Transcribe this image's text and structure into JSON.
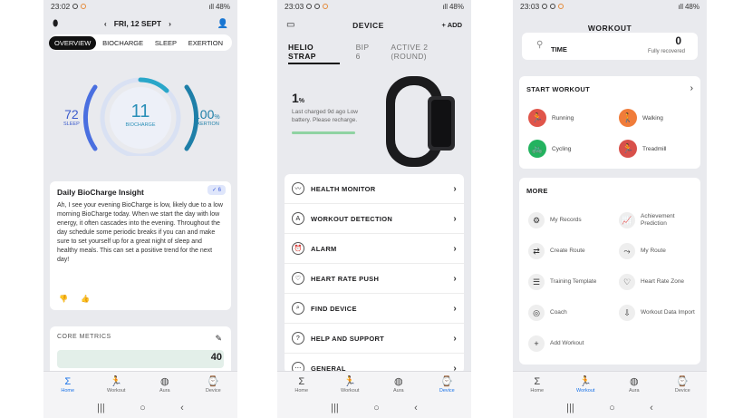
{
  "phone1": {
    "status": {
      "time": "23:02",
      "battery": "48%"
    },
    "date_label": "FRI, 12 SEPT",
    "tabs": [
      "OVERVIEW",
      "BIOCHARGE",
      "SLEEP",
      "EXERTION"
    ],
    "gauges": {
      "sleep": {
        "value": "72",
        "label": "SLEEP"
      },
      "biocharge": {
        "value": "11",
        "label": "BIOCHARGE"
      },
      "exertion": {
        "value": "100",
        "unit": "%",
        "label": "EXERTION"
      }
    },
    "insight": {
      "title": "Daily BioCharge Insight",
      "badge": "6",
      "text": "Ah, I see your evening BioCharge is low, likely due to a low morning BioCharge today. When we start the day with low energy, it often cascades into the evening. Throughout the day schedule some periodic breaks if you can and make sure to set yourself up for a great night of sleep and healthy meals. This can set a positive trend for the next day!"
    },
    "core": {
      "title": "CORE METRICS",
      "value": "40"
    },
    "nav": [
      "Home",
      "Workout",
      "Aura",
      "Device"
    ]
  },
  "phone2": {
    "status": {
      "time": "23:03",
      "battery": "48%"
    },
    "title": "DEVICE",
    "add_label": "ADD",
    "device_tabs": [
      "HELIO STRAP",
      "BIP 6",
      "ACTIVE 2 (ROUND)"
    ],
    "battery": {
      "value": "1",
      "unit": "%",
      "note": "Last charged 9d ago Low battery. Please recharge.",
      "level": 0.01
    },
    "menu": [
      {
        "label": "HEALTH MONITOR",
        "icon": "heart-monitor-icon",
        "glyph": "〰"
      },
      {
        "label": "WORKOUT DETECTION",
        "icon": "workout-detection-icon",
        "glyph": "A"
      },
      {
        "label": "ALARM",
        "icon": "alarm-icon",
        "glyph": "⏰"
      },
      {
        "label": "HEART RATE PUSH",
        "icon": "heart-icon",
        "glyph": "♡"
      },
      {
        "label": "FIND DEVICE",
        "icon": "find-device-icon",
        "glyph": "⌕"
      },
      {
        "label": "HELP AND SUPPORT",
        "icon": "help-icon",
        "glyph": "?"
      },
      {
        "label": "GENERAL",
        "icon": "more-icon",
        "glyph": "⋯"
      }
    ],
    "nav": [
      "Home",
      "Workout",
      "Aura",
      "Device"
    ]
  },
  "phone3": {
    "status": {
      "time": "23:03",
      "battery": "48%"
    },
    "title": "WORKOUT",
    "time_card": {
      "label": "TIME",
      "status": "Fully recovered",
      "value": "0"
    },
    "start_title": "START WORKOUT",
    "activities": [
      {
        "label": "Running",
        "color": "#e0554a",
        "icon": "running-icon"
      },
      {
        "label": "Walking",
        "color": "#f07c3a",
        "icon": "walking-icon"
      },
      {
        "label": "Cycling",
        "color": "#23b35f",
        "icon": "cycling-icon"
      },
      {
        "label": "Treadmill",
        "color": "#d8504a",
        "icon": "treadmill-icon"
      }
    ],
    "more_title": "MORE",
    "more_items": [
      {
        "label": "My Records",
        "icon": "records-icon",
        "glyph": "⚙"
      },
      {
        "label": "Achievement Prediction",
        "icon": "prediction-icon",
        "glyph": "📈"
      },
      {
        "label": "Create Route",
        "icon": "create-route-icon",
        "glyph": "⇄"
      },
      {
        "label": "My Route",
        "icon": "my-route-icon",
        "glyph": "⤳"
      },
      {
        "label": "Training Template",
        "icon": "template-icon",
        "glyph": "☰"
      },
      {
        "label": "Heart Rate Zone",
        "icon": "heart-zone-icon",
        "glyph": "♡"
      },
      {
        "label": "Coach",
        "icon": "coach-icon",
        "glyph": "◎"
      },
      {
        "label": "Workout Data Import",
        "icon": "import-icon",
        "glyph": "⇩"
      },
      {
        "label": "Add Workout",
        "icon": "add-workout-icon",
        "glyph": "+"
      }
    ],
    "nav": [
      "Home",
      "Workout",
      "Aura",
      "Device"
    ]
  },
  "colors": {
    "accent": "#1a73e8",
    "gauge_blue": "#4a6fe0",
    "gauge_teal": "#2aa7c9",
    "exertion": "#1e7fa8"
  }
}
